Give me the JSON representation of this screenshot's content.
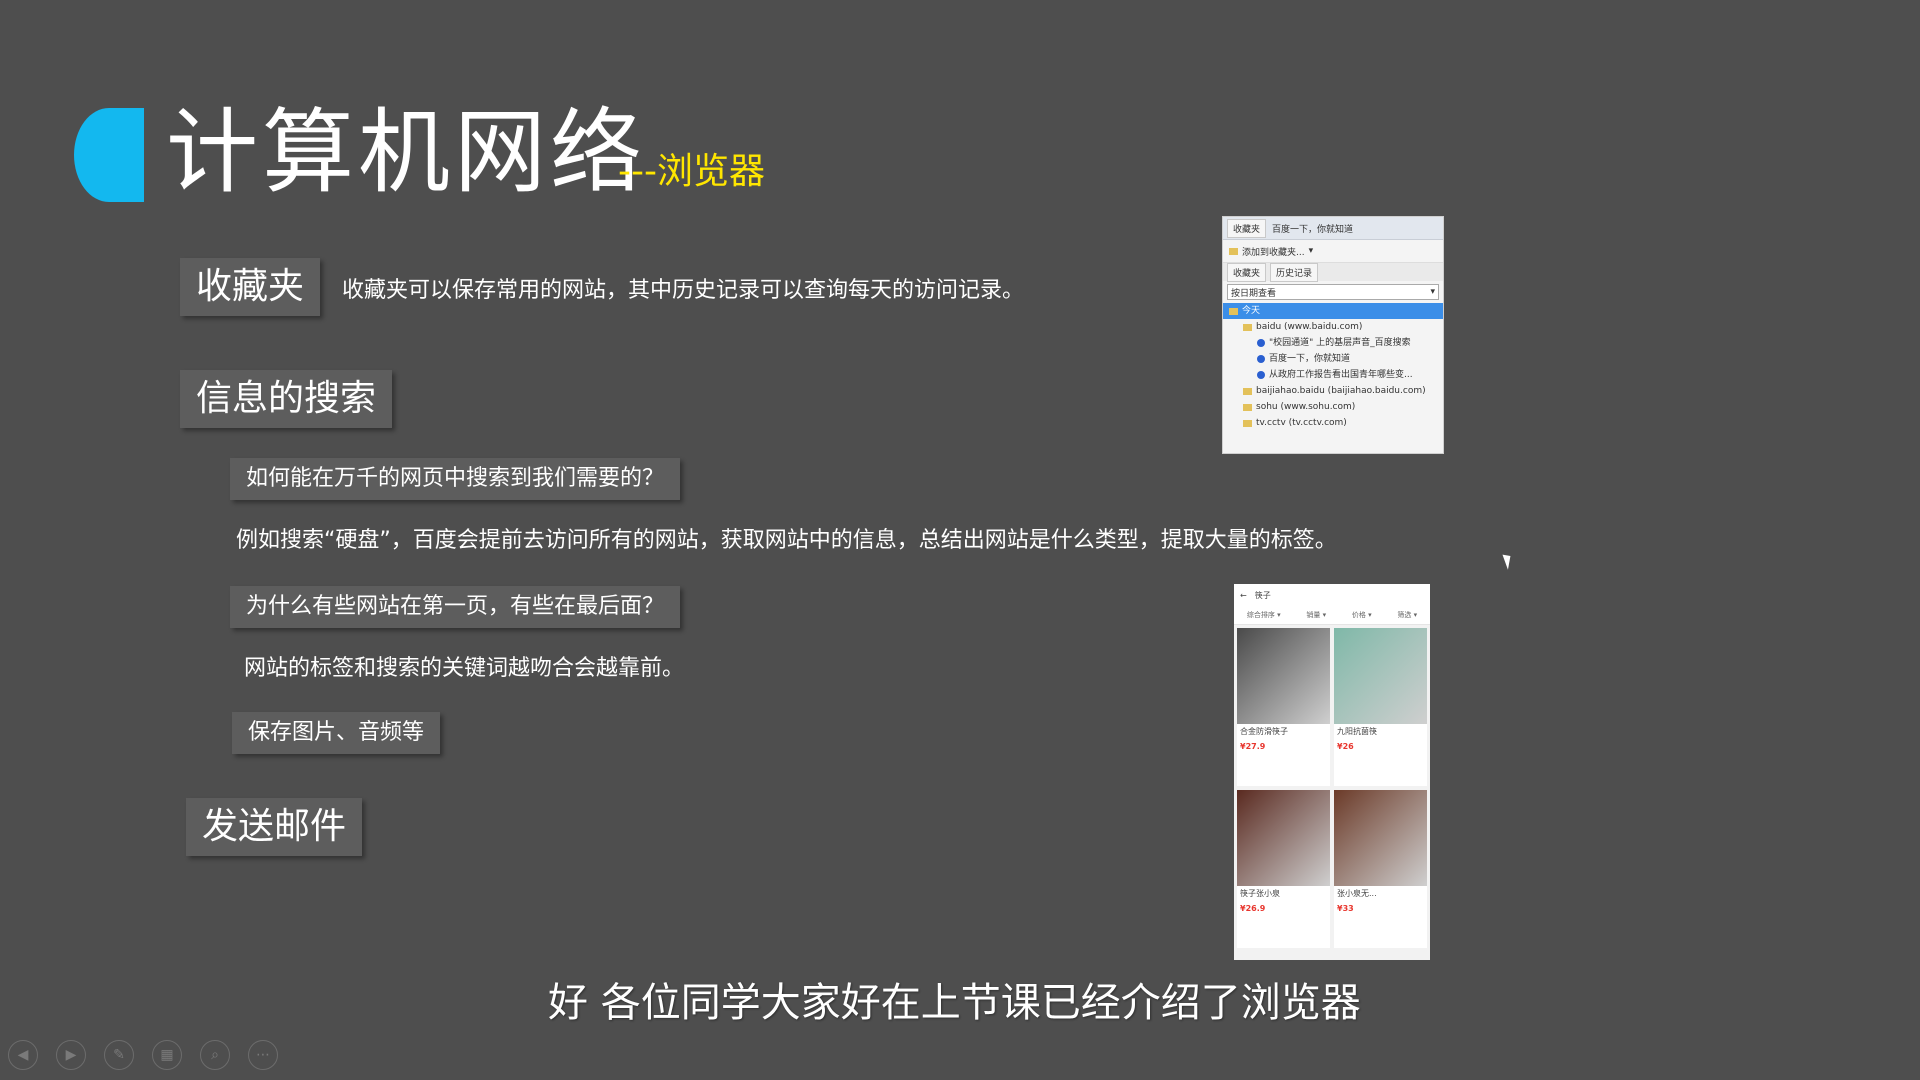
{
  "slide": {
    "title": "计算机网络",
    "subtitle": "---浏览器",
    "sections": {
      "favorites": {
        "label": "收藏夹",
        "desc": "收藏夹可以保存常用的网站，其中历史记录可以查询每天的访问记录。"
      },
      "search": {
        "label": "信息的搜索",
        "q1": "如何能在万千的网页中搜索到我们需要的？",
        "a1": "例如搜索“硬盘”，百度会提前去访问所有的网站，获取网站中的信息，总结出网站是什么类型，提取大量的标签。",
        "q2": "为什么有些网站在第一页，有些在最后面？",
        "a2": "网站的标签和搜索的关键词越吻合会越靠前。",
        "save": "保存图片、音频等"
      },
      "mail": {
        "label": "发送邮件"
      }
    }
  },
  "caption": "好  各位同学大家好在上节课已经介绍了浏览器",
  "favorites_panel": {
    "tab1": "收藏夹",
    "tab2": "百度一下，你就知道",
    "add_button": "添加到收藏夹...",
    "subtab1": "收藏夹",
    "subtab2": "历史记录",
    "view_select": "按日期查看",
    "rows": [
      {
        "text": "今天",
        "level": 0,
        "selected": true,
        "icon": "folder"
      },
      {
        "text": "baidu (www.baidu.com)",
        "level": 1,
        "selected": false,
        "icon": "folder"
      },
      {
        "text": "\"校园通道\" 上的基层声音_百度搜索",
        "level": 2,
        "selected": false,
        "icon": "paw"
      },
      {
        "text": "百度一下，你就知道",
        "level": 2,
        "selected": false,
        "icon": "paw"
      },
      {
        "text": "从政府工作报告看出国青年哪些变...",
        "level": 2,
        "selected": false,
        "icon": "paw"
      },
      {
        "text": "baijiahao.baidu (baijiahao.baidu.com)",
        "level": 1,
        "selected": false,
        "icon": "folder"
      },
      {
        "text": "sohu (www.sohu.com)",
        "level": 1,
        "selected": false,
        "icon": "folder"
      },
      {
        "text": "tv.cctv (tv.cctv.com)",
        "level": 1,
        "selected": false,
        "icon": "folder"
      }
    ]
  },
  "shop_screenshot": {
    "search_text": "筷子",
    "filters": [
      "综合排序",
      "销量",
      "价格",
      "筛选"
    ],
    "products": [
      {
        "name": "合金防滑筷子",
        "price": "¥27.9",
        "color": "#4a4a4a"
      },
      {
        "name": "九阳抗菌筷",
        "price": "¥26",
        "color": "#7fb8a8"
      },
      {
        "name": "筷子张小泉",
        "price": "¥26.9",
        "color": "#5a2a20"
      },
      {
        "name": "张小泉无...",
        "price": "¥33",
        "color": "#6b3a28"
      }
    ]
  },
  "toolbar_icons": [
    "prev-icon",
    "next-icon",
    "pen-icon",
    "slides-icon",
    "zoom-icon",
    "more-icon"
  ]
}
